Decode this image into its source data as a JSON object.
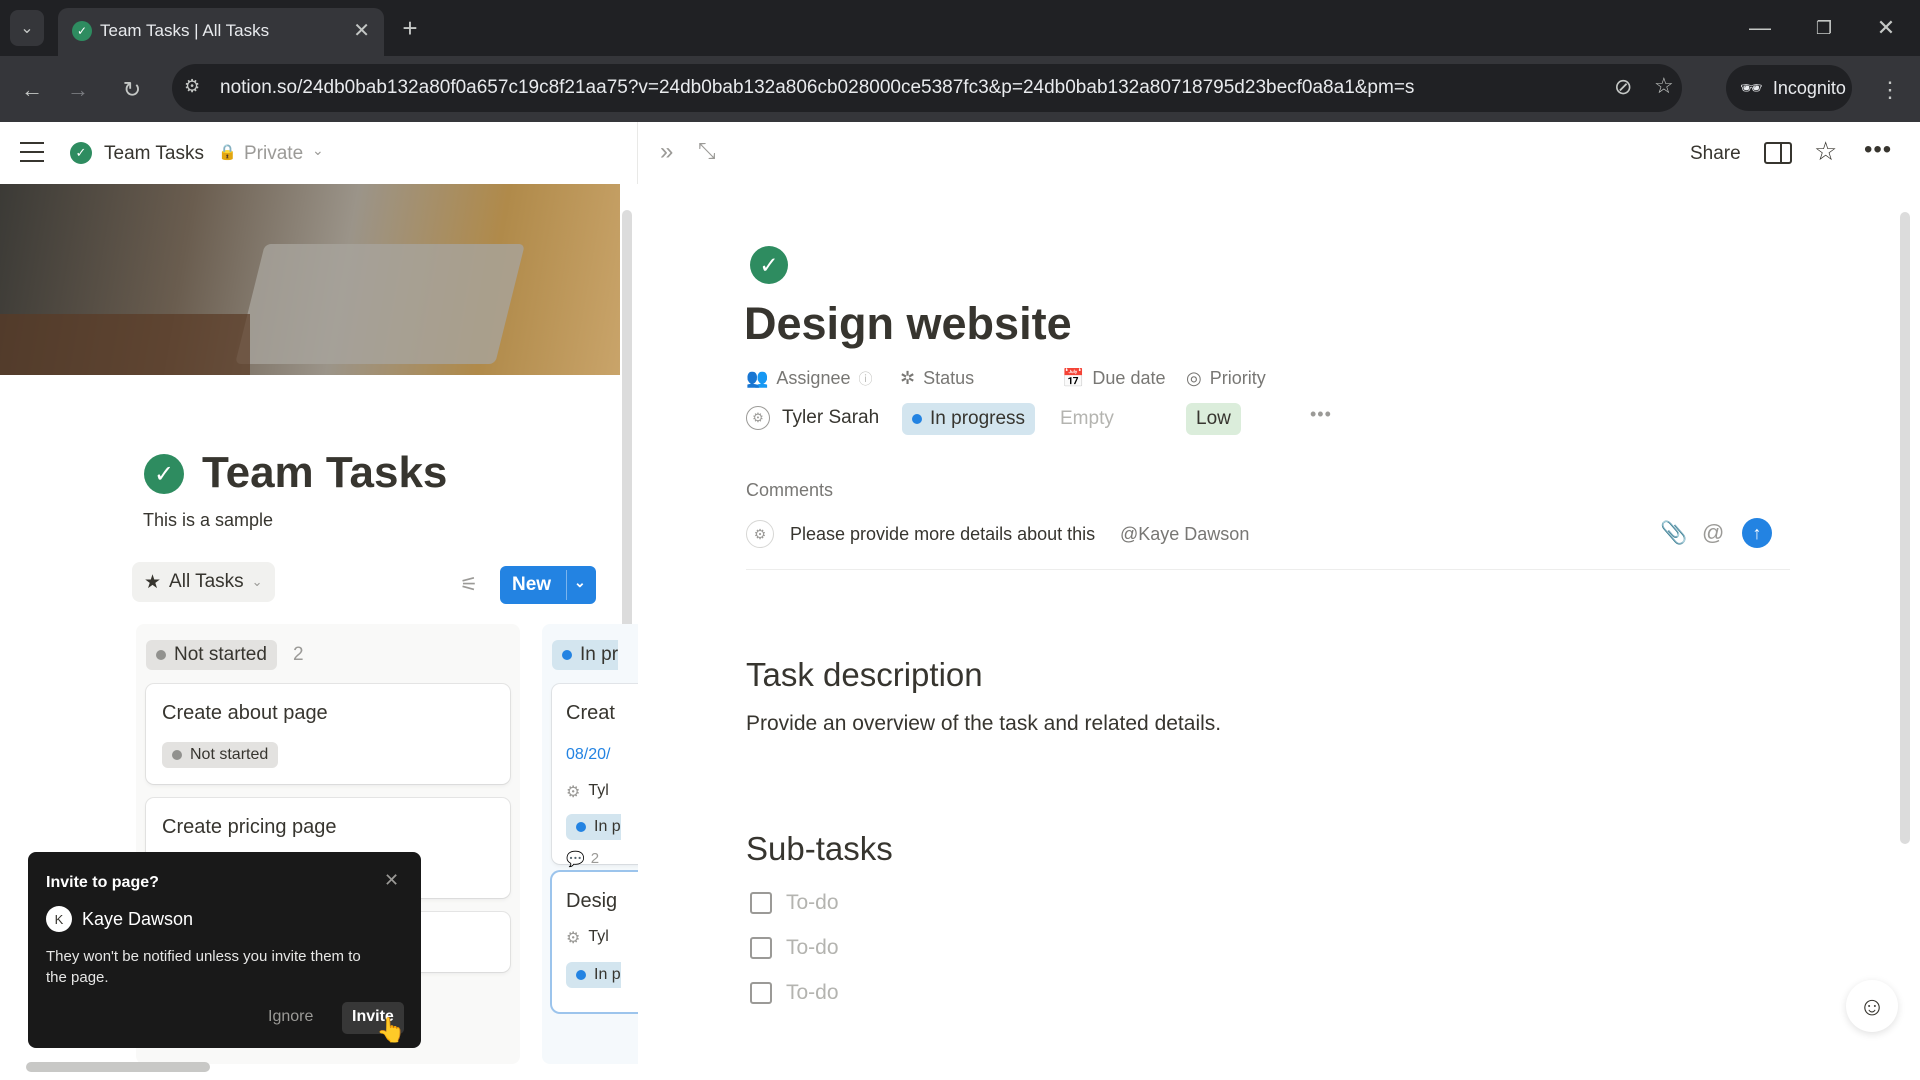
{
  "browser": {
    "tab_title": "Team Tasks | All Tasks",
    "url": "notion.so/24db0bab132a80f0a657c19c8f21aa75?v=24db0bab132a806cb028000ce5387fc3&p=24db0bab132a80718795d23becf0a8a1&pm=s",
    "incognito_label": "Incognito"
  },
  "topbar": {
    "page_name": "Team Tasks",
    "privacy": "Private",
    "share_label": "Share"
  },
  "database": {
    "title": "Team Tasks",
    "description": "This is a sample",
    "view_name": "All Tasks",
    "new_label": "New",
    "columns": [
      {
        "status": "Not started",
        "count": "2",
        "cards": [
          {
            "title": "Create about page",
            "status": "Not started"
          },
          {
            "title": "Create pricing page"
          }
        ]
      },
      {
        "status": "In pr",
        "cards": [
          {
            "title": "Creat",
            "date": "08/20/",
            "assignee": "Tyl",
            "status": "In p",
            "comments": "2"
          },
          {
            "title": "Desig",
            "assignee": "Tyl",
            "status": "In p"
          }
        ]
      }
    ]
  },
  "task": {
    "title": "Design website",
    "props": {
      "assignee_label": "Assignee",
      "status_label": "Status",
      "due_label": "Due date",
      "priority_label": "Priority",
      "assignee_value": "Tyler Sarah",
      "status_value": "In progress",
      "due_value": "Empty",
      "priority_value": "Low"
    },
    "comments_label": "Comments",
    "comment_text": "Please provide more details about this",
    "comment_mention": "@Kaye Dawson",
    "description_heading": "Task description",
    "description_text": "Provide an overview of the task and related details.",
    "subtasks_heading": "Sub-tasks",
    "subtasks": [
      "To-do",
      "To-do",
      "To-do"
    ]
  },
  "popup": {
    "title": "Invite to page?",
    "user": "Kaye Dawson",
    "avatar_letter": "K",
    "message": "They won't be notified unless you invite them to the page.",
    "ignore_label": "Ignore",
    "invite_label": "Invite"
  },
  "colors": {
    "accent": "#2383e2",
    "green_check": "#2e8c60",
    "in_progress_bg": "#d3e5ef",
    "not_started_bg": "#e3e2e0",
    "low_bg": "#dbeddb"
  }
}
